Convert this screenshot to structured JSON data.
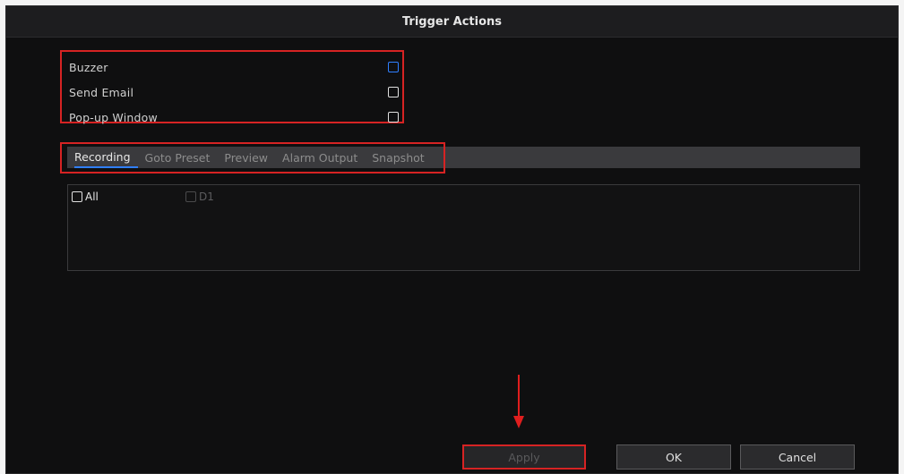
{
  "dialog": {
    "title": "Trigger Actions"
  },
  "actions": [
    {
      "label": "Buzzer",
      "checked": false
    },
    {
      "label": "Send Email",
      "checked": false
    },
    {
      "label": "Pop-up Window",
      "checked": false
    }
  ],
  "tabs": [
    {
      "label": "Recording",
      "active": true
    },
    {
      "label": "Goto Preset",
      "active": false
    },
    {
      "label": "Preview",
      "active": false
    },
    {
      "label": "Alarm Output",
      "active": false
    },
    {
      "label": "Snapshot",
      "active": false
    }
  ],
  "channels": {
    "all_label": "All",
    "d1_label": "D1"
  },
  "buttons": {
    "apply": "Apply",
    "ok": "OK",
    "cancel": "Cancel"
  },
  "colors": {
    "accent_blue": "#2f7fff",
    "highlight_red": "#d62323",
    "background": "#0f0f10"
  }
}
